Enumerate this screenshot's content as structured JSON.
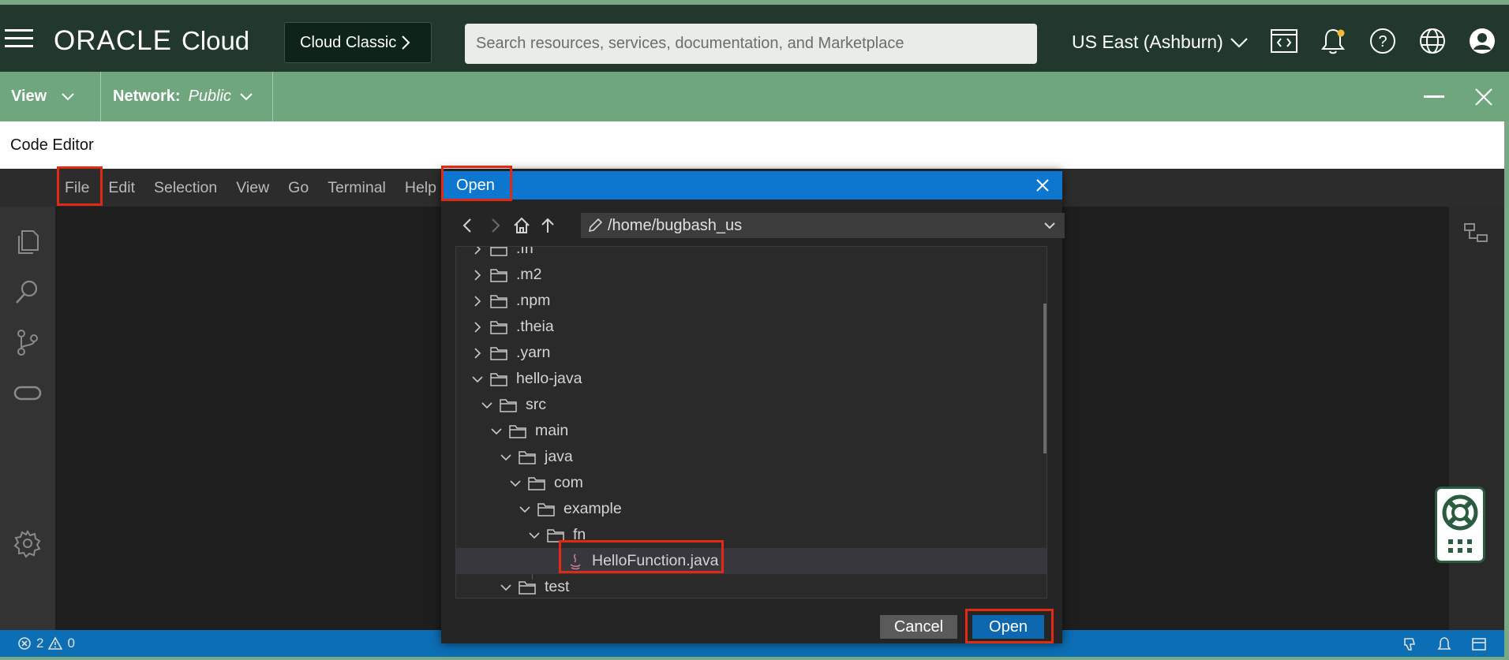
{
  "header": {
    "logo_oracle": "ORACLE",
    "logo_cloud": "Cloud",
    "classic_button": "Cloud Classic",
    "search_placeholder": "Search resources, services, documentation, and Marketplace",
    "region": "US East (Ashburn)",
    "icons": [
      "menu-icon",
      "code-editor-icon",
      "bell-icon",
      "help-icon",
      "globe-icon",
      "user-icon"
    ]
  },
  "viewbar": {
    "view_label": "View",
    "network_label": "Network:",
    "network_value": "Public"
  },
  "editor_title": "Code Editor",
  "menu": [
    "File",
    "Edit",
    "Selection",
    "View",
    "Go",
    "Terminal",
    "Help"
  ],
  "dialog": {
    "title": "Open",
    "path": "/home/bugbash_us",
    "tree": [
      {
        "label": ".fn",
        "expanded": false
      },
      {
        "label": ".m2",
        "expanded": false
      },
      {
        "label": ".npm",
        "expanded": false
      },
      {
        "label": ".theia",
        "expanded": false
      },
      {
        "label": ".yarn",
        "expanded": false
      },
      {
        "label": "hello-java",
        "expanded": true
      },
      {
        "label": "src",
        "expanded": true
      },
      {
        "label": "main",
        "expanded": true
      },
      {
        "label": "java",
        "expanded": true
      },
      {
        "label": "com",
        "expanded": true
      },
      {
        "label": "example",
        "expanded": true
      },
      {
        "label": "fn",
        "expanded": true
      },
      {
        "label": "HelloFunction.java",
        "type": "file",
        "selected": true
      },
      {
        "label": "test",
        "expanded": true
      }
    ],
    "cancel_label": "Cancel",
    "open_label": "Open"
  },
  "status": {
    "errors": "2",
    "warnings": "0"
  },
  "colors": {
    "oracle_dark": "#22382c",
    "oracle_green": "#6fa67d",
    "highlight": "#e02b12",
    "status_blue": "#0c6eb5",
    "dialog_head": "#0d77cf"
  }
}
